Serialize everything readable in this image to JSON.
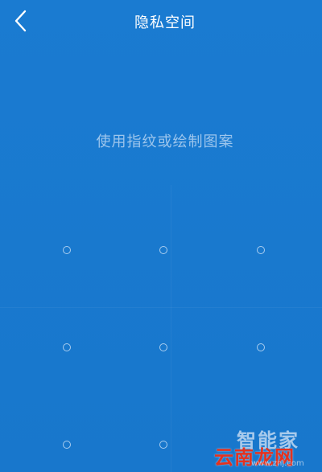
{
  "header": {
    "title": "隐私空间",
    "back_icon": "chevron-left-icon"
  },
  "prompt": {
    "text": "使用指纹或绘制图案"
  },
  "pattern": {
    "rows": 3,
    "cols": 3
  },
  "watermark": {
    "top_text": "智能家",
    "bottom_text": "云南龙网",
    "url_text": "www.znj.com"
  },
  "colors": {
    "background": "#1a7bd0",
    "title": "#ffffff",
    "prompt": "#9cc5ec",
    "dot": "#a9cdef",
    "watermark_red": "#e3321f"
  }
}
